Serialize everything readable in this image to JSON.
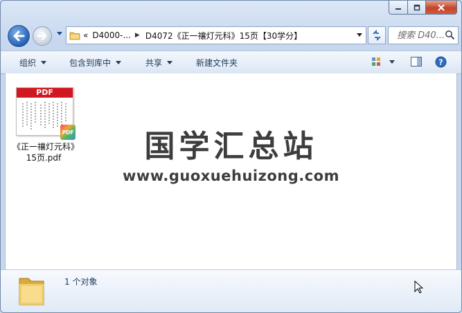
{
  "window": {
    "caption_icons": [
      "minimize-icon",
      "maximize-icon",
      "close-icon"
    ]
  },
  "address_bar": {
    "overflow_marker": "«",
    "crumbs": [
      "D4000-...",
      "D4072《正一禳灯元科》15页【30学分】"
    ]
  },
  "search": {
    "placeholder": "搜索 D40..."
  },
  "toolbar": {
    "organize": "组织",
    "include_in_library": "包含到库中",
    "share": "共享",
    "new_folder": "新建文件夹"
  },
  "file": {
    "name": "《正一禳灯元科》15页.pdf",
    "thumb_band": "PDF",
    "badge": "PDF"
  },
  "watermark": {
    "title": "国学汇总站",
    "url": "www.guoxuehuizong.com"
  },
  "status": {
    "item_count": "1 个对象"
  },
  "colors": {
    "pdf_red": "#d1171f",
    "toolbar_text": "#1e395b",
    "frame_blue": "#c6d7ee"
  }
}
